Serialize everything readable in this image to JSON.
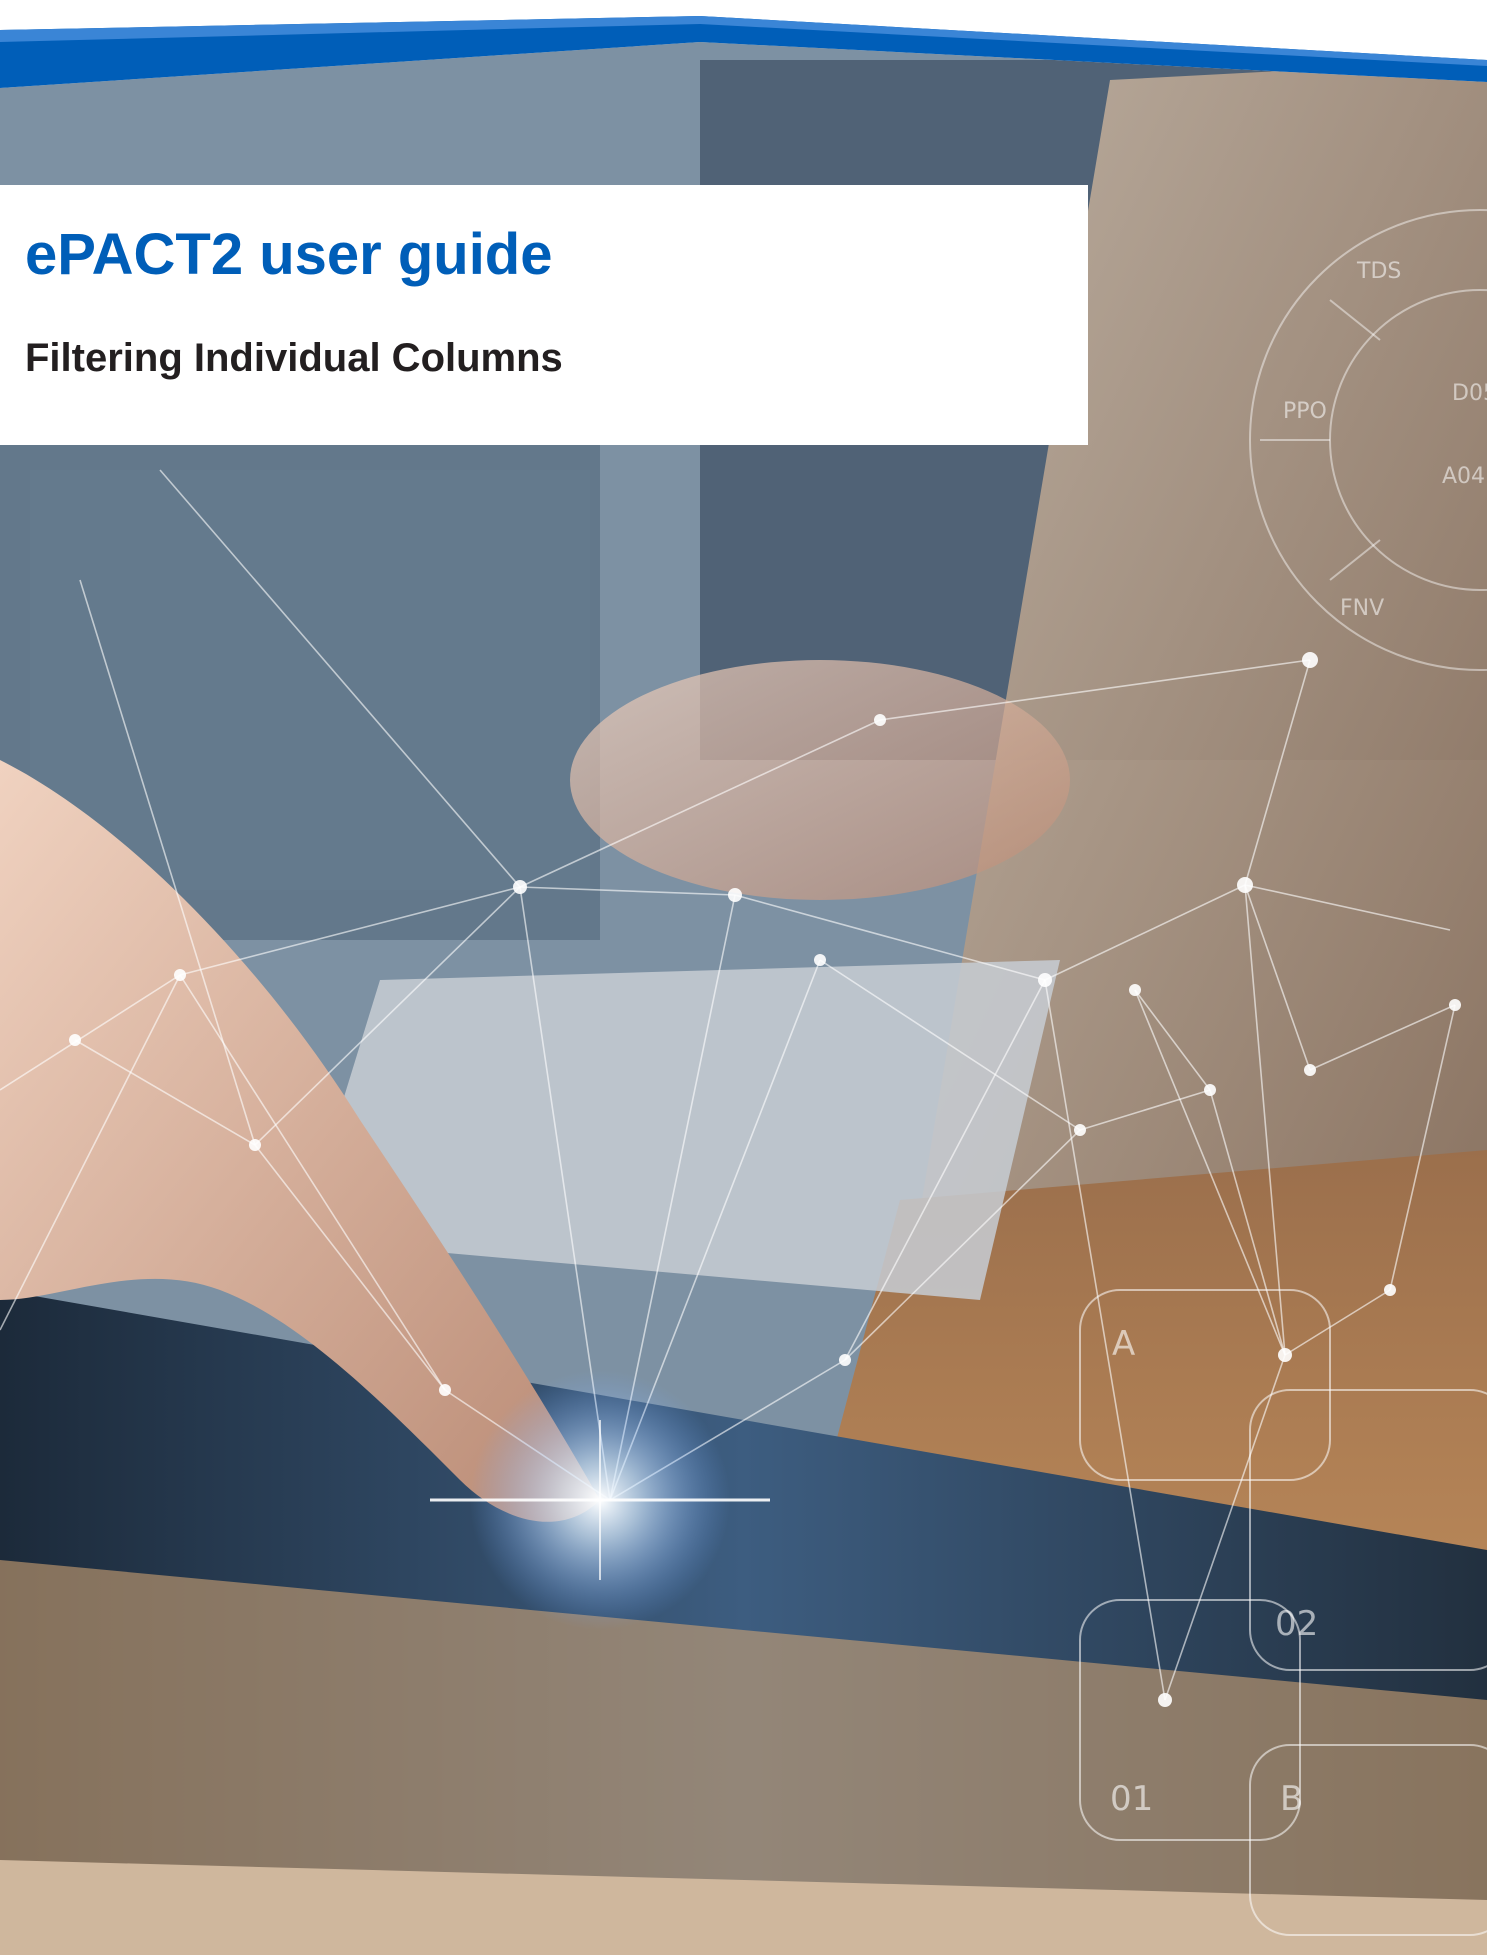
{
  "document": {
    "title": "ePACT2 user guide",
    "subtitle": "Filtering Individual Columns"
  },
  "colors": {
    "brand_blue": "#005eb8",
    "subtitle_text": "#231f20",
    "title_box": "#ffffff"
  },
  "background_decor": {
    "ring_labels": [
      "TDS",
      "PPO",
      "D05",
      "A04",
      "FNV"
    ],
    "tile_labels": [
      "A",
      "02",
      "01",
      "B"
    ]
  }
}
